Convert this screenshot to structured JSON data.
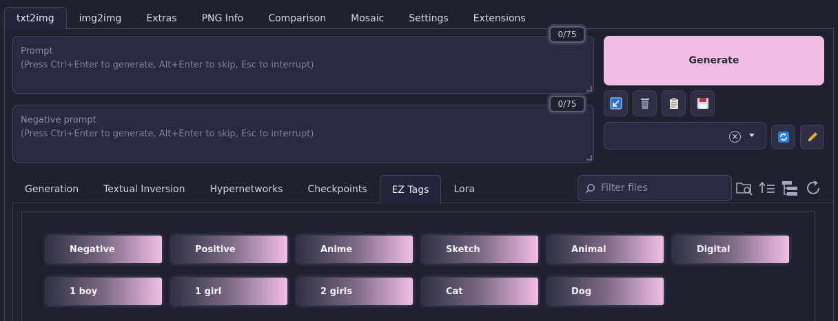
{
  "top_tabs": [
    "txt2img",
    "img2img",
    "Extras",
    "PNG Info",
    "Comparison",
    "Mosaic",
    "Settings",
    "Extensions"
  ],
  "prompt": {
    "label": "Prompt",
    "hint": "(Press Ctrl+Enter to generate, Alt+Enter to skip, Esc to interrupt)",
    "token_count": "0/75"
  },
  "negative_prompt": {
    "label": "Negative prompt",
    "hint": "(Press Ctrl+Enter to generate, Alt+Enter to skip, Esc to interrupt)",
    "token_count": "0/75"
  },
  "generate": {
    "label": "Generate"
  },
  "sub_tabs": [
    "Generation",
    "Textual Inversion",
    "Hypernetworks",
    "Checkpoints",
    "EZ Tags",
    "Lora"
  ],
  "filter": {
    "placeholder": "Filter files"
  },
  "tags_row1": [
    "Negative",
    "Positive",
    "Anime",
    "Sketch",
    "Animal",
    "Digital"
  ],
  "tags_row2": [
    "1 boy",
    "1 girl",
    "2 girls",
    "Cat",
    "Dog"
  ],
  "colors": {
    "accent": "#f1bde4",
    "background": "#1f2130",
    "panel": "#272a40"
  }
}
